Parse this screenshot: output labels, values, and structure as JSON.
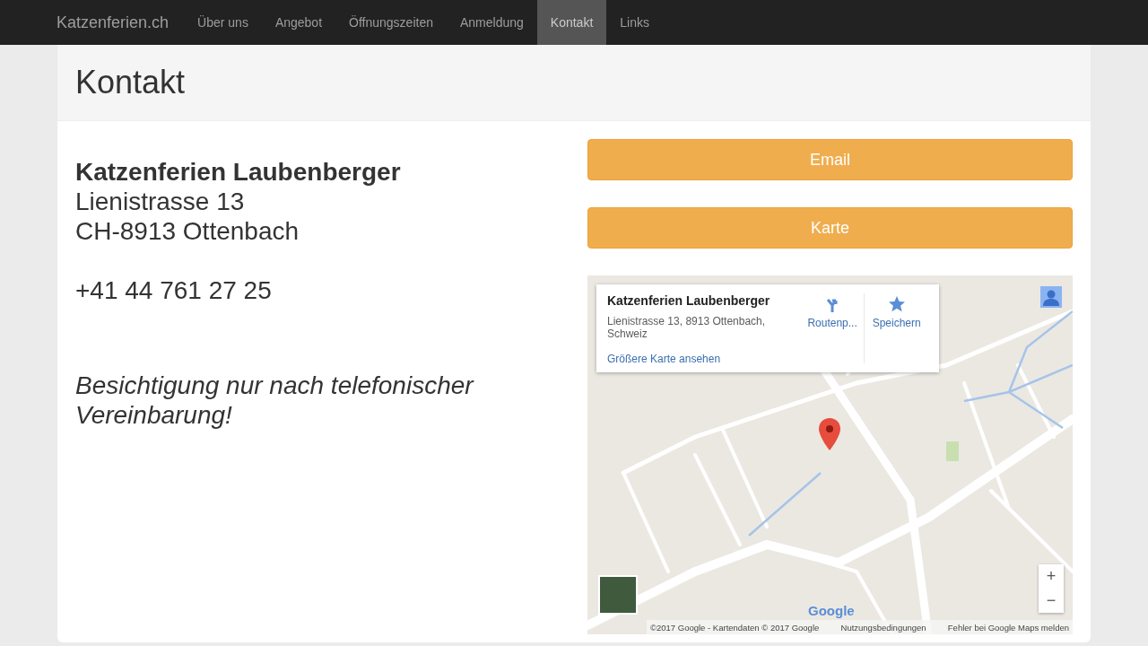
{
  "navbar": {
    "brand": "Katzenferien.ch",
    "items": [
      {
        "label": "Über uns",
        "selected": false
      },
      {
        "label": "Angebot",
        "selected": false
      },
      {
        "label": "Öffnungszeiten",
        "selected": false
      },
      {
        "label": "Anmeldung",
        "selected": false
      },
      {
        "label": "Kontakt",
        "selected": true
      },
      {
        "label": "Links",
        "selected": false
      }
    ]
  },
  "page_title": "Kontakt",
  "address": {
    "name": "Katzenferien Laubenberger",
    "street": "Lienistrasse 13",
    "city": "CH-8913 Ottenbach",
    "phone": "+41 44 761 27 25"
  },
  "note": "Besichtigung nur nach telefonischer Vereinbarung!",
  "buttons": [
    "Email",
    "Karte"
  ],
  "map": {
    "card": {
      "title": "Katzenferien Laubenberger",
      "address": "Lienistrasse 13, 8913 Ottenbach, Schweiz",
      "link": "Größere Karte ansehen",
      "actions": [
        "Routenp...",
        "Speichern"
      ]
    },
    "logo": "Google",
    "zoom_in": "+",
    "zoom_out": "−",
    "footer": [
      "©2017 Google - Kartendaten © 2017 Google",
      "Nutzungsbedingungen",
      "Fehler bei Google Maps melden"
    ]
  }
}
